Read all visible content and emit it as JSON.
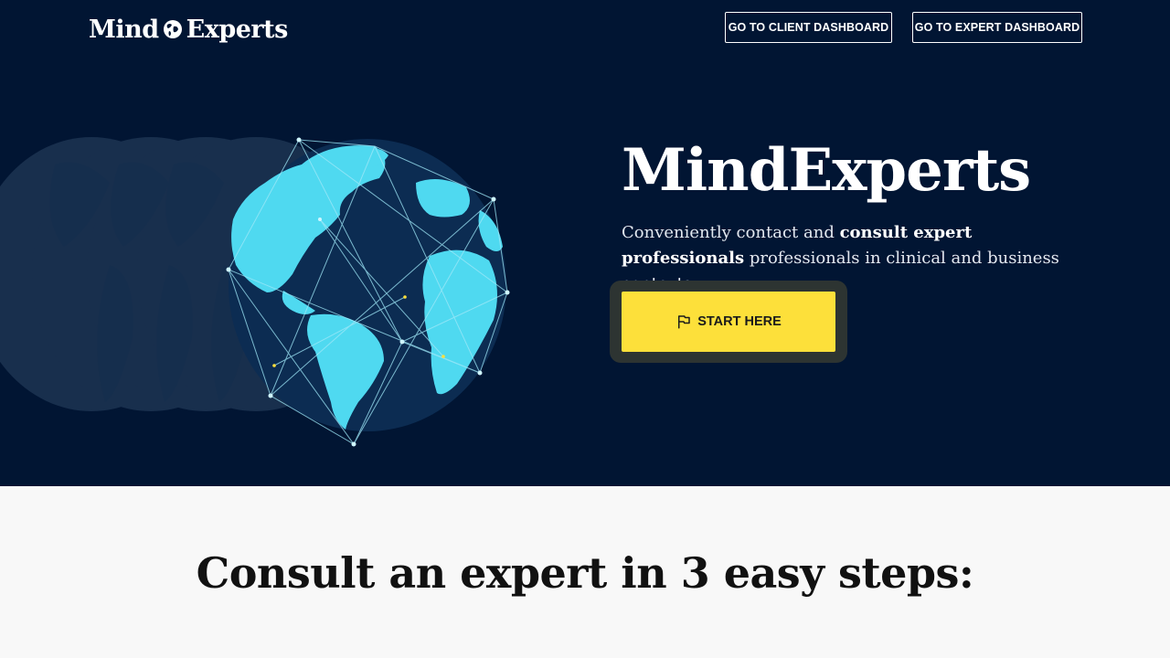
{
  "header": {
    "logo_left": "Mind",
    "logo_right": "Experts",
    "logo_icon": "globe-icon",
    "client_dashboard_label": "GO TO CLIENT DASHBOARD",
    "expert_dashboard_label": "GO TO EXPERT DASHBOARD"
  },
  "hero": {
    "title": "MindExperts",
    "text_before": "Conveniently contact and ",
    "text_bold": "consult expert professionals",
    "text_after": " professionals in clinical and business contexts.",
    "cta_label": "START HERE",
    "cta_icon": "flag-icon",
    "illustration": "network-globe-illustration"
  },
  "steps": {
    "heading": "Consult an expert in 3 easy steps:"
  },
  "colors": {
    "hero_background": "#011533",
    "globe_land": "#4fd9f0",
    "cta_background": "#fde03a",
    "cta_halo": "#2d3432",
    "page_background": "#f8f8f8"
  }
}
